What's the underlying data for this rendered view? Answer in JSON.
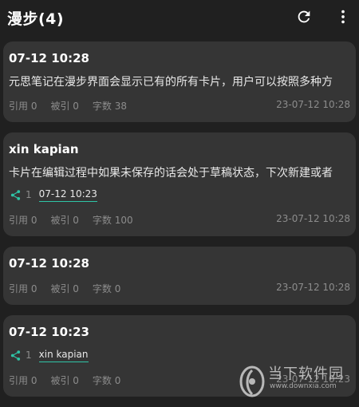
{
  "appbar": {
    "title": "漫步(4)",
    "refresh_icon": "refresh-icon",
    "more_icon": "more-vert-icon"
  },
  "cards": [
    {
      "title": "07-12 10:28",
      "body": "元思笔记在漫步界面会显示已有的所有卡片，用户可以按照多种方",
      "cited": "引用 0",
      "cited_by": "被引 0",
      "word_count": "字数 38",
      "date": "23-07-12 10:28"
    },
    {
      "title": "xin kapian",
      "body": "卡片在编辑过程中如果未保存的话会处于草稿状态，下次新建或者",
      "link_count": "1",
      "link_label": "07-12 10:23",
      "cited": "引用 0",
      "cited_by": "被引 0",
      "word_count": "字数 100",
      "date": "23-07-12 10:28"
    },
    {
      "title": "07-12 10:28",
      "cited": "引用 0",
      "cited_by": "被引 0",
      "word_count": "字数 0",
      "date": "23-07-12 10:28"
    },
    {
      "title": "07-12 10:23",
      "link_count": "1",
      "link_label": "xin kapian",
      "cited": "引用 0",
      "cited_by": "被引 0",
      "word_count": "字数 0",
      "date": "23-07-12 10:23"
    }
  ],
  "watermark": {
    "text": "当下软件园",
    "url": "www.downxia.com"
  },
  "colors": {
    "background": "#202020",
    "card": "#353535",
    "accent": "#2fc4a6",
    "muted": "#8c8c8c"
  }
}
